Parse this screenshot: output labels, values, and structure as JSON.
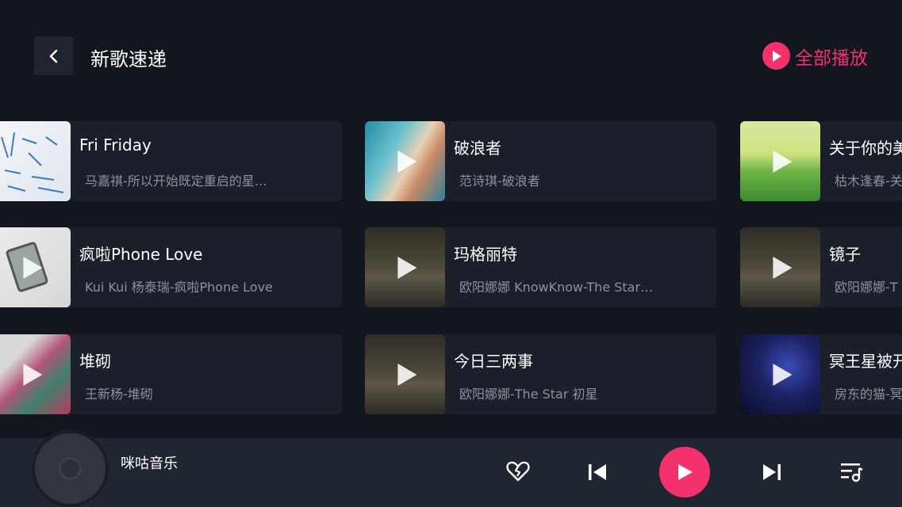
{
  "header": {
    "title": "新歌速递",
    "play_all_label": "全部播放"
  },
  "colors": {
    "accent": "#f4306d",
    "background": "#12161e",
    "card": "#1a1f29",
    "subtext": "#8c919b"
  },
  "songs": [
    {
      "title": "Fri Friday",
      "subtitle": "马嘉祺-所以开始既定重启的星…"
    },
    {
      "title": "破浪者",
      "subtitle": "范诗琪-破浪者"
    },
    {
      "title": "关于你的美",
      "subtitle": "枯木逢春-关"
    },
    {
      "title": "疯啦Phone Love",
      "subtitle": "Kui Kui 杨泰瑞-疯啦Phone Love"
    },
    {
      "title": "玛格丽特",
      "subtitle": "欧阳娜娜 KnowKnow-The Star…"
    },
    {
      "title": "镜子",
      "subtitle": "欧阳娜娜-T"
    },
    {
      "title": "堆砌",
      "subtitle": "王新杨-堆砌"
    },
    {
      "title": "今日三两事",
      "subtitle": "欧阳娜娜-The Star 初星"
    },
    {
      "title": "冥王星被开",
      "subtitle": "房东的猫-冥"
    }
  ],
  "player": {
    "track_title": "咪咕音乐"
  },
  "icons": {
    "back": "chevron-left-icon",
    "play_all": "play-circle-icon",
    "like": "heart-icon",
    "previous": "skip-previous-icon",
    "play": "play-icon",
    "next": "skip-next-icon",
    "playlist": "playlist-music-icon"
  }
}
